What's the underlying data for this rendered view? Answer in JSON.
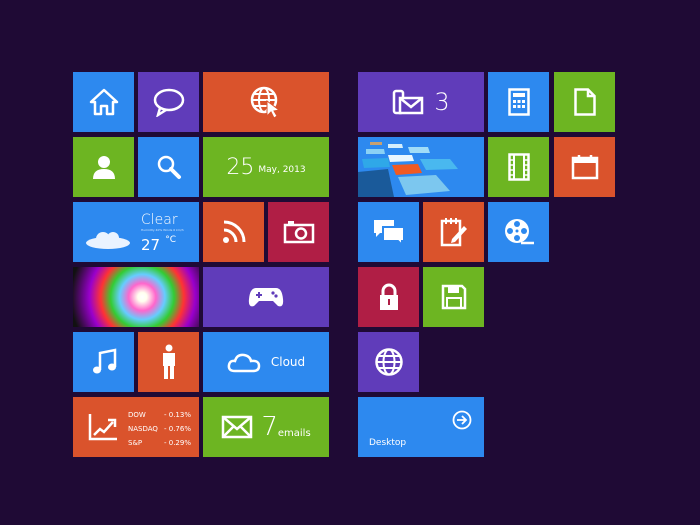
{
  "colors": {
    "background": "#1f0a35",
    "blue": "#2d89ef",
    "purple": "#603cba",
    "orange": "#da532c",
    "green": "#6db522",
    "red": "#b01e45"
  },
  "date": {
    "day": "25",
    "month_year": "May, 2013"
  },
  "weather": {
    "condition": "Clear",
    "details": "Humidity 40%  Winds 6 km/h",
    "temperature": "27",
    "unit": "°C"
  },
  "cloud": {
    "label": "Cloud"
  },
  "stocks": [
    {
      "name": "DOW",
      "change": "- 0.13%"
    },
    {
      "name": "NASDAQ",
      "change": "- 0.76%"
    },
    {
      "name": "S&P",
      "change": "- 0.29%"
    }
  ],
  "mail": {
    "count": "7",
    "label": "emails"
  },
  "messages": {
    "count": "3"
  },
  "desktop": {
    "label": "Desktop"
  },
  "icons": [
    "home-icon",
    "chat-icon",
    "browser-icon",
    "user-icon",
    "search-icon",
    "rss-icon",
    "camera-icon",
    "gamepad-icon",
    "music-icon",
    "person-icon",
    "cloud-icon",
    "chart-icon",
    "mail-icon",
    "message-icon",
    "calculator-icon",
    "document-icon",
    "film-icon",
    "calendar-icon",
    "chat-bubbles-icon",
    "notes-icon",
    "film-reel-icon",
    "lock-icon",
    "save-icon",
    "globe-icon",
    "arrow-right-icon"
  ]
}
